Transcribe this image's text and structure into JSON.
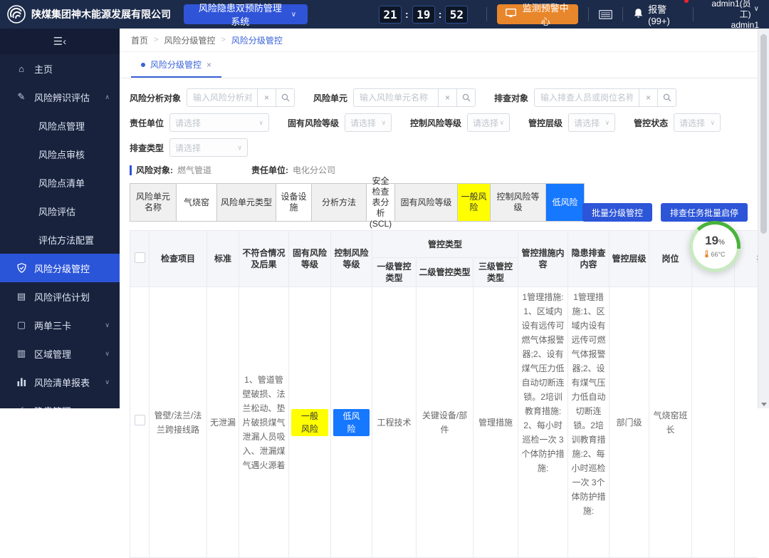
{
  "colors": {
    "primary": "#2f54d8",
    "topbar_bg": "#1c2b4a",
    "sidebar_bg": "#18223d",
    "active_item": "#2b55d9",
    "orange": "#e8862b",
    "risk_yellow": "#ffff00",
    "risk_blue": "#1677ff",
    "gauge_green": "#49b33b"
  },
  "topbar": {
    "company": "陕煤集团神木能源发展有限公司",
    "system_select": "风险隐患双预防管理系统",
    "clock": {
      "h": "21",
      "m": "19",
      "s": "52",
      "sep": ":"
    },
    "monitor_button": "监测预警中心",
    "alarm_label": "报警(99+)",
    "user_role": "admin1(员工)",
    "user_name": "admin1"
  },
  "sidebar": {
    "items": [
      {
        "label": "主页"
      },
      {
        "label": "风险辨识评估"
      },
      {
        "label": "风险点管理"
      },
      {
        "label": "风险点审核"
      },
      {
        "label": "风险点清单"
      },
      {
        "label": "风险评估"
      },
      {
        "label": "评估方法配置"
      },
      {
        "label": "风险分级管控"
      },
      {
        "label": "风险评估计划"
      },
      {
        "label": "两单三卡"
      },
      {
        "label": "区域管理"
      },
      {
        "label": "风险清单报表"
      },
      {
        "label": "隐患管理"
      }
    ]
  },
  "breadcrumb": {
    "items": [
      "首页",
      "风险分级管控",
      "风险分级管控"
    ],
    "separator": ">"
  },
  "tab": {
    "label": "风险分级管控",
    "close": "×"
  },
  "filters": {
    "search1": {
      "label": "风险分析对象",
      "placeholder": "输入风险分析对象",
      "value": ""
    },
    "search2": {
      "label": "风险单元",
      "placeholder": "输入风险单元名称",
      "value": ""
    },
    "search3": {
      "label": "排查对象",
      "placeholder": "输入排查人员或岗位名称",
      "value": ""
    },
    "select1": {
      "label": "责任单位",
      "value": "请选择"
    },
    "select2": {
      "label": "固有风险等级",
      "value": "请选择"
    },
    "select3": {
      "label": "控制风险等级",
      "value": "请选择"
    },
    "select4": {
      "label": "管控层级",
      "value": "请选择"
    },
    "select5": {
      "label": "管控状态",
      "value": "请选择"
    },
    "select6": {
      "label": "排查类型",
      "value": "请选择"
    },
    "clear_icon": "×"
  },
  "info": {
    "risk_object_label": "风险对象:",
    "risk_object": "燃气管道",
    "unit_label": "责任单位:",
    "unit": "电化分公司"
  },
  "summary": {
    "cells": [
      {
        "text": "风险单元名称",
        "kind": "label"
      },
      {
        "text": "气烧窑",
        "kind": "value"
      },
      {
        "text": "风险单元类型",
        "kind": "label"
      },
      {
        "text": "设备设施",
        "kind": "value"
      },
      {
        "text": "分析方法",
        "kind": "label"
      },
      {
        "text": "安全检查表分析(SCL)",
        "kind": "value"
      },
      {
        "text": "固有风险等级",
        "kind": "label"
      },
      {
        "text": "一般风险",
        "kind": "yellow"
      },
      {
        "text": "控制风险等级",
        "kind": "label"
      },
      {
        "text": "低风险",
        "kind": "blue"
      }
    ]
  },
  "actions": {
    "batch_control": "批量分级管控",
    "batch_toggle": "排查任务批量启停"
  },
  "table": {
    "headers": {
      "cols": [
        "检查项目",
        "标准",
        "不符合情况及后果",
        "固有风险等级",
        "控制风险等级"
      ],
      "group": "管控类型",
      "subcols": [
        "一级管控类型",
        "二级管控类型",
        "三级管控类型"
      ],
      "cols2": [
        "管控措施内容",
        "隐患排查内容",
        "管控层级",
        "岗位",
        "排",
        "排"
      ]
    },
    "row": {
      "check_item": "管壁/法兰/法兰跨接线路",
      "standard": "无泄漏",
      "consequence": "1、管道管壁破损、法兰松动、垫片破损煤气泄漏人员吸入、泄漏煤气遇火源着",
      "inherent_risk": "一般风险",
      "control_risk": "低风险",
      "type_l1": "工程技术",
      "type_l2": "关键设备/部件",
      "type_l3": "管理措施",
      "measures": "1管理措施:1、区域内设有远传可燃气体报警器;2、设有煤气压力低自动切断连锁。2培训教育措施:2、每小时巡检一次 3个体防护措施:",
      "inspection": "1管理措施:1、区域内设有远传可燃气体报警器;2、设有煤气压力低自动切断连锁。2培训教育措施:2、每小时巡检一次 3个体防护措施:",
      "level": "部门级",
      "post": "气烧窑班长",
      "extra1": "",
      "extra2": ""
    }
  },
  "widget": {
    "percent": "19",
    "sign": "%",
    "temperature": "66°C"
  }
}
